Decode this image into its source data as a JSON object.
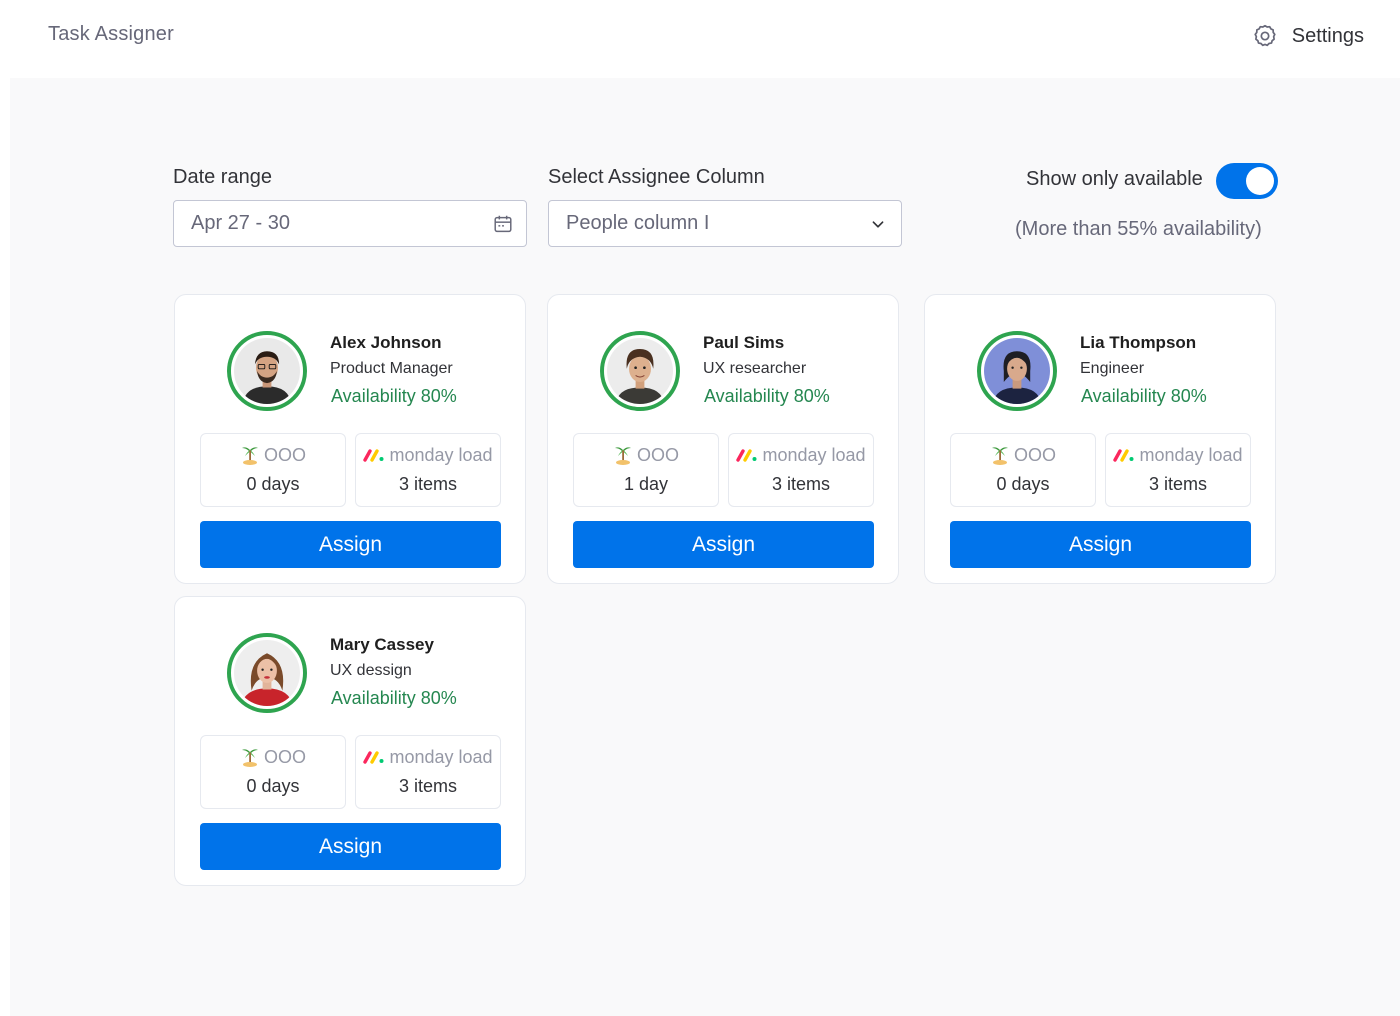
{
  "app": {
    "title": "Task Assigner"
  },
  "header": {
    "settings_label": "Settings",
    "settings_icon": "gear-icon"
  },
  "filters": {
    "date_range": {
      "label": "Date range",
      "value": "Apr 27 - 30",
      "icon": "calendar-icon"
    },
    "assignee_column": {
      "label": "Select Assignee Column",
      "value": "People column I",
      "icon": "chevron-down-icon"
    },
    "availability_toggle": {
      "label": "Show only available",
      "enabled": true,
      "note": "(More than 55% availability)"
    }
  },
  "colors": {
    "accent": "#0073ea",
    "availability": "#258750",
    "ring": "#2ea44f"
  },
  "people": [
    {
      "name": "Alex Johnson",
      "role": "Product Manager",
      "availability": "Availability 80%",
      "ooo_label": "OOO",
      "ooo_value": "0 days",
      "load_label": "monday load",
      "load_value": "3 items",
      "button": "Assign"
    },
    {
      "name": "Paul Sims",
      "role": "UX researcher",
      "availability": "Availability 80%",
      "ooo_label": "OOO",
      "ooo_value": "1 day",
      "load_label": "monday load",
      "load_value": "3 items",
      "button": "Assign"
    },
    {
      "name": "Lia Thompson",
      "role": "Engineer",
      "availability": "Availability 80%",
      "ooo_label": "OOO",
      "ooo_value": "0 days",
      "load_label": "monday load",
      "load_value": "3 items",
      "button": "Assign"
    },
    {
      "name": "Mary Cassey",
      "role": "UX dessign",
      "availability": "Availability 80%",
      "ooo_label": "OOO",
      "ooo_value": "0 days",
      "load_label": "monday load",
      "load_value": "3 items",
      "button": "Assign"
    }
  ]
}
